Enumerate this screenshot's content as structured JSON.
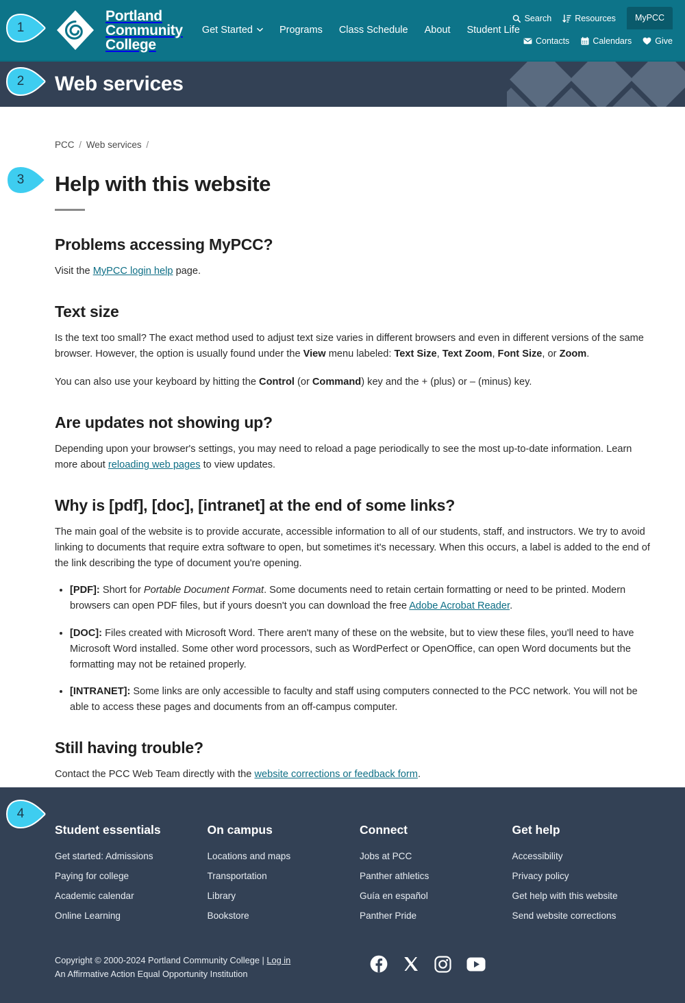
{
  "brand": {
    "logo_line1": "Portland",
    "logo_line2": "Community",
    "logo_line3": "College",
    "logo_icon": "pcc-diamond-spiral-logo",
    "header_color": "#0d7489",
    "banner_color": "#334155",
    "link_color": "#0d6e85",
    "marker_color": "#3ecdf0"
  },
  "header": {
    "nav": [
      {
        "label": "Get Started",
        "has_chevron": true,
        "icon": "chevron-down-icon"
      },
      {
        "label": "Programs",
        "has_chevron": false
      },
      {
        "label": "Class Schedule",
        "has_chevron": false
      },
      {
        "label": "About",
        "has_chevron": false
      },
      {
        "label": "Student Life",
        "has_chevron": false
      }
    ],
    "utility_row1": [
      {
        "label": "Search",
        "icon": "search-icon"
      },
      {
        "label": "Resources",
        "icon": "sort-amount-icon"
      }
    ],
    "mypcc_label": "MyPCC",
    "utility_row2": [
      {
        "label": "Contacts",
        "icon": "envelope-icon"
      },
      {
        "label": "Calendars",
        "icon": "calendar-icon"
      },
      {
        "label": "Give",
        "icon": "heart-icon"
      }
    ]
  },
  "banner": {
    "title": "Web services"
  },
  "breadcrumb": {
    "item1": "PCC",
    "item2": "Web services",
    "sep": "/"
  },
  "main": {
    "title": "Help with this website",
    "sections": {
      "mypcc": {
        "heading": "Problems accessing MyPCC?",
        "text_before": "Visit the ",
        "link": "MyPCC login help",
        "text_after": " page."
      },
      "text_size": {
        "heading": "Text size",
        "p1_a": "Is the text too small? The exact method used to adjust text size varies in different browsers and even in different versions of the same browser. However, the option is usually found under the ",
        "p1_b1": "View",
        "p1_c": " menu labeled: ",
        "p1_b2": "Text Size",
        "p1_d": ", ",
        "p1_b3": "Text Zoom",
        "p1_e": ", ",
        "p1_b4": "Font Size",
        "p1_f": ", or ",
        "p1_b5": "Zoom",
        "p1_g": ".",
        "p2_a": "You can also use your keyboard by hitting the ",
        "p2_b1": "Control",
        "p2_c": " (or ",
        "p2_b2": "Command",
        "p2_d": ") key and the + (plus) or – (minus) key."
      },
      "updates": {
        "heading": "Are updates not showing up?",
        "p_a": "Depending upon your browser's settings, you may need to reload a page periodically to see the most up-to-date information. Learn more about ",
        "link": "reloading web pages",
        "p_b": " to view updates."
      },
      "labels": {
        "heading": "Why is [pdf], [doc], [intranet] at the end of some links?",
        "p": "The main goal of the website is to provide accurate, accessible information to all of our students, staff, and instructors. We try to avoid linking to documents that require extra software to open, but sometimes it's necessary. When this occurs, a label is added to the end of the link describing the type of document you're opening.",
        "bullet_pdf_label": "[PDF]:",
        "bullet_pdf_a": " Short for ",
        "bullet_pdf_i": "Portable Document Format",
        "bullet_pdf_b": ". Some documents need to retain certain formatting or need to be printed. Modern browsers can open PDF files, but if yours doesn't you can download the free ",
        "bullet_pdf_link": "Adobe Acrobat Reader",
        "bullet_pdf_c": ".",
        "bullet_doc_label": "[DOC]:",
        "bullet_doc_text": " Files created with Microsoft Word. There aren't many of these on the website, but to view these files, you'll need to have Microsoft Word installed. Some other word processors, such as WordPerfect or OpenOffice, can open Word documents but the formatting may not be retained properly.",
        "bullet_intranet_label": "[INTRANET]:",
        "bullet_intranet_text": " Some links are only accessible to faculty and staff using computers connected to the PCC network. You will not be able to access these pages and documents from an off-campus computer."
      },
      "trouble": {
        "heading": "Still having trouble?",
        "p_a": "Contact the PCC Web Team directly with the ",
        "link": "website corrections or feedback form",
        "p_b": "."
      }
    }
  },
  "footer": {
    "columns": [
      {
        "heading": "Student essentials",
        "links": [
          "Get started: Admissions",
          "Paying for college",
          "Academic calendar",
          "Online Learning"
        ]
      },
      {
        "heading": "On campus",
        "links": [
          "Locations and maps",
          "Transportation",
          "Library",
          "Bookstore"
        ]
      },
      {
        "heading": "Connect",
        "links": [
          "Jobs at PCC",
          "Panther athletics",
          "Guía en español",
          "Panther Pride"
        ]
      },
      {
        "heading": "Get help",
        "links": [
          "Accessibility",
          "Privacy policy",
          "Get help with this website",
          "Send website corrections"
        ]
      }
    ],
    "copyright_line1_a": "Copyright © 2000-2024 Portland Community College | ",
    "copyright_login": "Log in",
    "copyright_line2": "An Affirmative Action Equal Opportunity Institution",
    "socials": [
      {
        "name": "facebook-icon",
        "label": "Facebook"
      },
      {
        "name": "x-twitter-icon",
        "label": "X"
      },
      {
        "name": "instagram-icon",
        "label": "Instagram"
      },
      {
        "name": "youtube-icon",
        "label": "YouTube"
      }
    ]
  },
  "callouts": [
    {
      "number": "1"
    },
    {
      "number": "2"
    },
    {
      "number": "3"
    },
    {
      "number": "4"
    }
  ]
}
